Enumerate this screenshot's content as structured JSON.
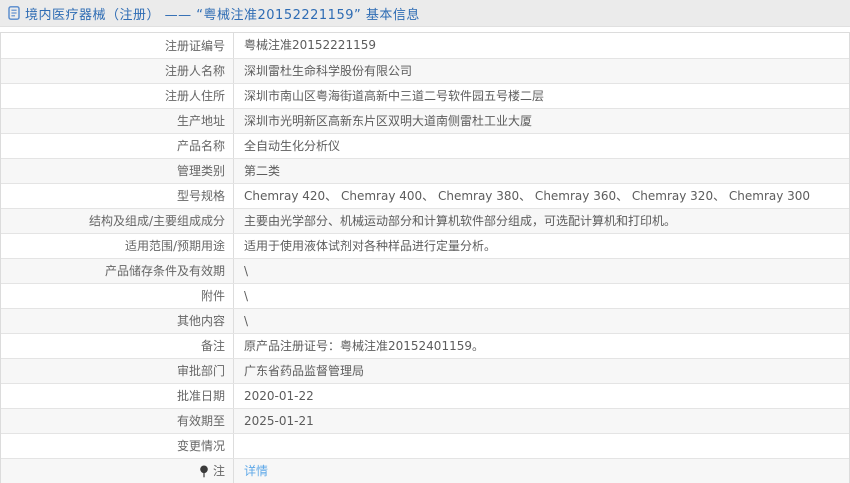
{
  "header": {
    "icon": "document-icon",
    "title": "境内医疗器械（注册） —— “粤械注准20152221159” 基本信息"
  },
  "table": {
    "rows": [
      {
        "label": "注册证编号",
        "value": "粤械注准20152221159"
      },
      {
        "label": "注册人名称",
        "value": "深圳雷杜生命科学股份有限公司"
      },
      {
        "label": "注册人住所",
        "value": "深圳市南山区粤海街道高新中三道二号软件园五号楼二层"
      },
      {
        "label": "生产地址",
        "value": "深圳市光明新区高新东片区双明大道南侧雷杜工业大厦"
      },
      {
        "label": "产品名称",
        "value": "全自动生化分析仪"
      },
      {
        "label": "管理类别",
        "value": "第二类"
      },
      {
        "label": "型号规格",
        "value": "Chemray 420、 Chemray 400、 Chemray 380、 Chemray 360、 Chemray 320、 Chemray 300"
      },
      {
        "label": "结构及组成/主要组成成分",
        "value": "主要由光学部分、机械运动部分和计算机软件部分组成，可选配计算机和打印机。"
      },
      {
        "label": "适用范围/预期用途",
        "value": "适用于使用液体试剂对各种样品进行定量分析。"
      },
      {
        "label": "产品储存条件及有效期",
        "value": "\\"
      },
      {
        "label": "附件",
        "value": "\\"
      },
      {
        "label": "其他内容",
        "value": "\\"
      },
      {
        "label": "备注",
        "value": "原产品注册证号：粤械注准20152401159。"
      },
      {
        "label": "审批部门",
        "value": "广东省药品监督管理局"
      },
      {
        "label": "批准日期",
        "value": "2020-01-22"
      },
      {
        "label": "有效期至",
        "value": "2025-01-21"
      },
      {
        "label": "变更情况",
        "value": ""
      },
      {
        "label": "注",
        "label_icon": "pin-icon",
        "value": "详情",
        "value_is_link": true
      }
    ]
  },
  "colors": {
    "header_bg": "#ebebeb",
    "title_color": "#2e6cb4",
    "border": "#dcdcdc",
    "row_alt_bg": "#f7f7f7",
    "label_color": "#666666",
    "value_color": "#5c5c5c",
    "link_color": "#5ea8e8",
    "icon_blue": "#5488cc",
    "pin_color": "#3a3a3a"
  }
}
